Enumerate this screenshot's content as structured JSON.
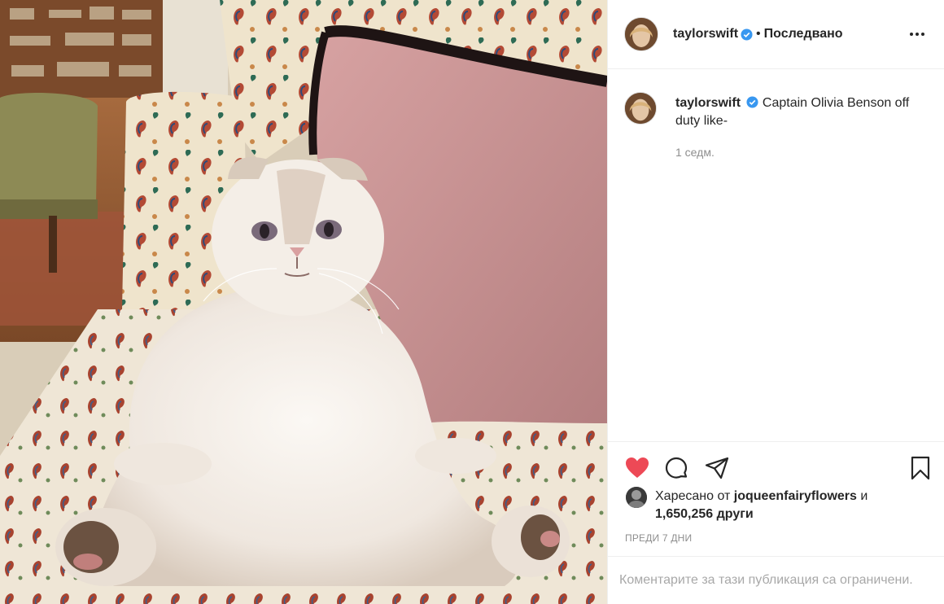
{
  "post": {
    "image_alt": "",
    "author": {
      "username": "taylorswift",
      "verified": true,
      "separator": "•",
      "follow_state": "Последвано"
    },
    "caption": {
      "username": "taylorswift",
      "text": "Captain Olivia Benson off duty like-",
      "time_ago": "1 седм."
    },
    "actions": {
      "like_icon": "heart-filled-icon",
      "comment_icon": "comment-icon",
      "share_icon": "paper-plane-icon",
      "save_icon": "bookmark-icon",
      "liked": true,
      "like_color": "#ed4956"
    },
    "likes": {
      "prefix": "Харесано от",
      "liker": "joqueenfairyflowers",
      "conjunction": "и",
      "count_text": "1,650,256 други"
    },
    "date_label": "ПРЕДИ 7 ДНИ",
    "comments_disabled": "Коментарите за тази публикация са ограничени."
  }
}
